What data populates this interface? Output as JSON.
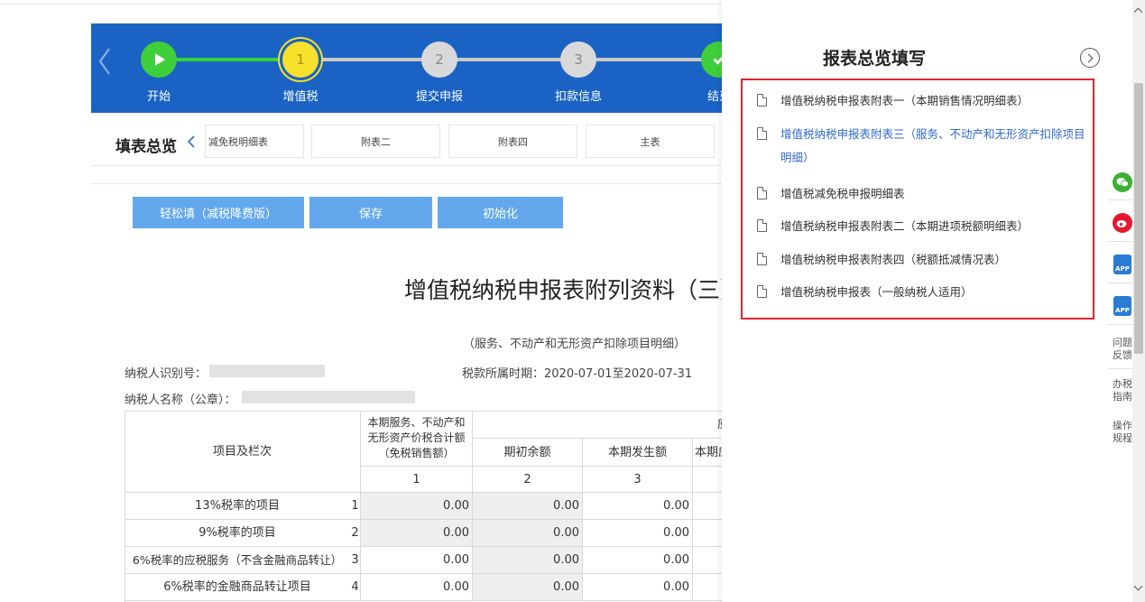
{
  "stepper": {
    "steps": [
      {
        "label": "开始",
        "number": "",
        "state": "done"
      },
      {
        "label": "增值税",
        "number": "1",
        "state": "current"
      },
      {
        "label": "提交申报",
        "number": "2",
        "state": "todo"
      },
      {
        "label": "扣款信息",
        "number": "3",
        "state": "todo"
      },
      {
        "label": "结束",
        "number": "",
        "state": "done"
      }
    ]
  },
  "tabbar": {
    "title": "填表总览",
    "tabs": [
      "减免税明细表",
      "附表二",
      "附表四",
      "主表"
    ]
  },
  "toolbar": {
    "easy_fill_label": "轻松填（减税降费版）",
    "save_label": "保存",
    "init_label": "初始化"
  },
  "form": {
    "title": "增值税纳税申报表附列资料（三）",
    "subtitle": "（服务、不动产和无形资产扣除项目明细）",
    "taxpayer_id_label": "纳税人识别号：",
    "taxpayer_name_label": "纳税人名称（公章）：",
    "period": "税款所属时期：2020-07-01至2020-07-31"
  },
  "table": {
    "header_item": "项目及栏次",
    "header_col1": "本期服务、不动产和无形资产价税合计额（免税销售额）",
    "header_group": "应税服务扣除项目",
    "header_col2": "期初余额",
    "header_col3": "本期发生额",
    "header_col4": "本期应扣除金额",
    "col_numbers": [
      "1",
      "2",
      "3"
    ],
    "rows": [
      {
        "name": "13%税率的项目",
        "line": "1",
        "c1": "0.00",
        "c2": "0.00",
        "c3": "0.00"
      },
      {
        "name": "9%税率的项目",
        "line": "2",
        "c1": "0.00",
        "c2": "0.00",
        "c3": "0.00"
      },
      {
        "name": "6%税率的应税服务（不含金融商品转让）",
        "line": "3",
        "c1": "0.00",
        "c2": "0.00",
        "c3": "0.00"
      },
      {
        "name": "6%税率的金融商品转让项目",
        "line": "4",
        "c1": "0.00",
        "c2": "0.00",
        "c3": "0.00"
      }
    ]
  },
  "panel": {
    "title": "报表总览填写",
    "reports": [
      {
        "label": "增值税纳税申报表附表一（本期销售情况明细表）",
        "active": false
      },
      {
        "label": "增值税纳税申报表附表三（服务、不动产和无形资产扣除项目明细）",
        "active": true
      },
      {
        "label": "增值税减免税申报明细表",
        "active": false
      },
      {
        "label": "增值税纳税申报表附表二（本期进项税额明细表）",
        "active": false
      },
      {
        "label": "增值税纳税申报表附表四（税额抵减情况表）",
        "active": false
      },
      {
        "label": "增值税纳税申报表（一般纳税人适用）",
        "active": false
      }
    ]
  },
  "float_bar": {
    "app_label": "APP",
    "feedback": "问题反馈",
    "guide": "办税指南",
    "rules": "操作规程",
    "colors": {
      "wechat": "#3cb034",
      "weibo": "#e6162d",
      "app": "#2a7bd4"
    }
  }
}
